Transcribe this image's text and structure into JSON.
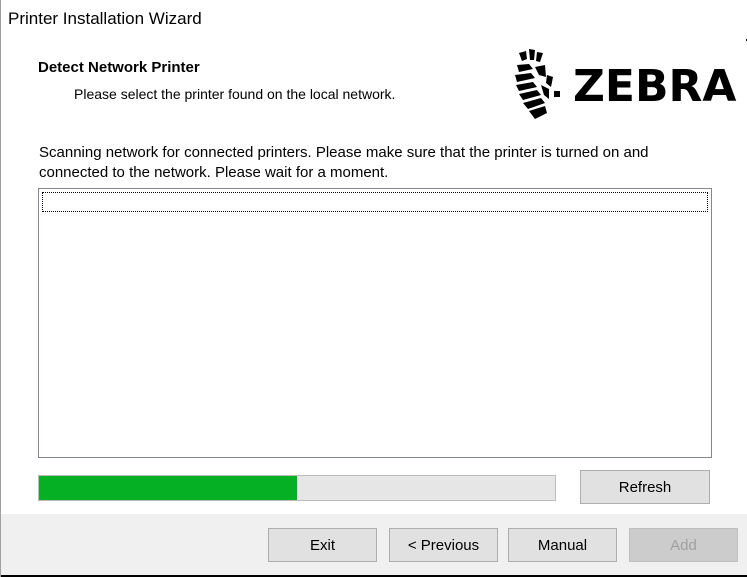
{
  "window": {
    "title": "Printer Installation Wizard"
  },
  "header": {
    "title": "Detect Network Printer",
    "subtitle": "Please select the printer found on the local network.",
    "logo_text": "ZEBRA"
  },
  "main": {
    "description": "Scanning network for connected printers. Please make sure that the printer is turned on and connected to the network. Please wait for a moment.",
    "printer_list": [],
    "progress_percent": 50,
    "refresh_label": "Refresh"
  },
  "footer": {
    "exit_label": "Exit",
    "previous_label": "< Previous",
    "manual_label": "Manual",
    "add_label": "Add"
  },
  "colors": {
    "progress_fill": "#06b025",
    "progress_track": "#e6e6e6",
    "button_face": "#e1e1e1",
    "footer_bg": "#f0f0f0"
  }
}
